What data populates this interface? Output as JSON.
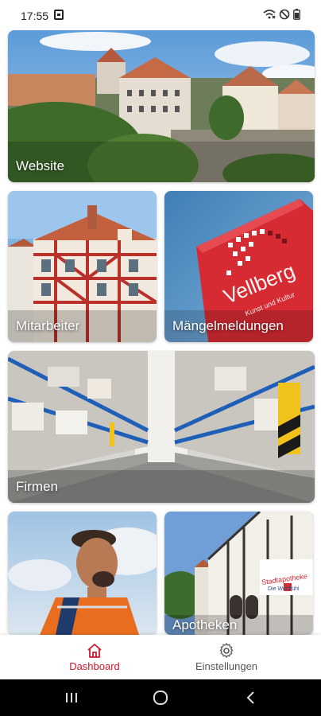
{
  "status": {
    "time": "17:55"
  },
  "cards": [
    {
      "id": "website",
      "label": "Website"
    },
    {
      "id": "mitarbeiter",
      "label": "Mitarbeiter"
    },
    {
      "id": "maengel",
      "label": "Mängelmeldungen",
      "sign_text": "Vellberg",
      "sign_subtext": "Kunst und Kultur"
    },
    {
      "id": "firmen",
      "label": "Firmen"
    },
    {
      "id": "kontakt",
      "label": ""
    },
    {
      "id": "apotheken",
      "label": "Apotheken",
      "shop_sign": "Stadtapotheke",
      "shop_sub": "Die Wohlfühl"
    }
  ],
  "nav": {
    "dashboard_label": "Dashboard",
    "settings_label": "Einstellungen",
    "dashboard_icon": "home-icon",
    "settings_icon": "gear-icon"
  },
  "colors": {
    "accent": "#d0182c"
  }
}
